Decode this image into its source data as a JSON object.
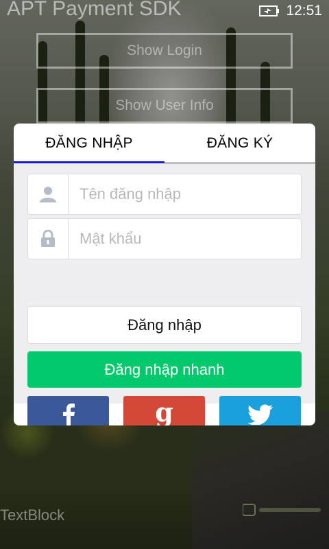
{
  "status_bar": {
    "time": "12:51",
    "battery_icon": "battery-charging-icon"
  },
  "background_app": {
    "title": "APT Payment SDK",
    "buttons": [
      "Show Login",
      "Show User Info"
    ],
    "textblock": "TextBlock"
  },
  "dialog": {
    "tabs": [
      {
        "label": "ĐĂNG NHẬP",
        "active": true
      },
      {
        "label": "ĐĂNG KÝ",
        "active": false
      }
    ],
    "username": {
      "icon": "user-icon",
      "placeholder": "Tên đăng nhập",
      "value": ""
    },
    "password": {
      "icon": "lock-icon",
      "placeholder": "Mật khẩu",
      "value": ""
    },
    "login_label": "Đăng nhập",
    "quick_login_label": "Đăng nhập nhanh",
    "social": [
      {
        "icon": "facebook-icon",
        "color": "#3b5998"
      },
      {
        "icon": "google-icon",
        "color": "#d34836"
      },
      {
        "icon": "twitter-icon",
        "color": "#1aa1db"
      }
    ],
    "colors": {
      "tab_underline": "#1a1adf",
      "quick_login": "#00c96b"
    }
  }
}
